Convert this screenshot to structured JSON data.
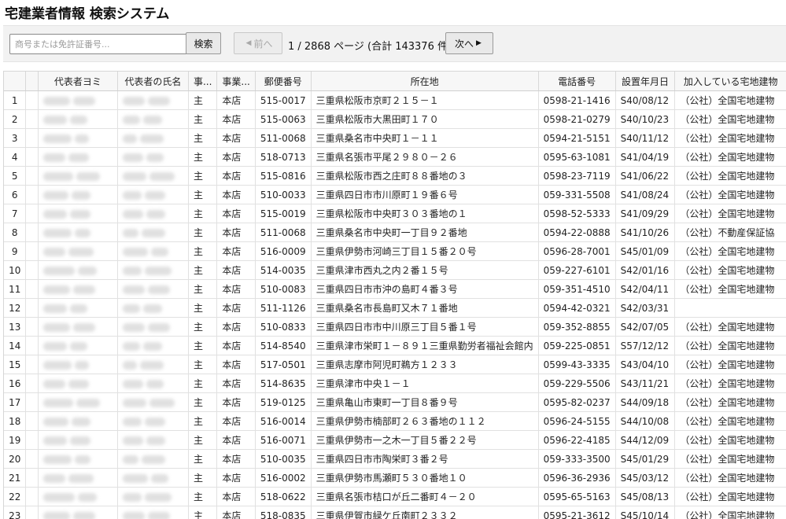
{
  "app": {
    "title": "宅建業者情報 検索システム"
  },
  "toolbar": {
    "search_placeholder": "商号または免許証番号...",
    "search_value": "",
    "search_label": "検索",
    "prev_label": "前へ",
    "next_label": "次へ",
    "page_info": "1 / 2868 ページ (合計 143376 件)"
  },
  "table": {
    "columns": [
      "",
      "",
      "代表者ヨミ",
      "代表者の氏名",
      "事...",
      "事業...",
      "郵便番号",
      "所在地",
      "電話番号",
      "設置年月日",
      "加入している宅地建物"
    ],
    "rows": [
      {
        "n": "1",
        "kind": "主",
        "office": "本店",
        "zip": "515-0017",
        "addr": "三重県松阪市京町２１５－１",
        "tel": "0598-21-1416",
        "date": "S40/08/12",
        "assoc": "（公社）全国宅地建物"
      },
      {
        "n": "2",
        "kind": "主",
        "office": "本店",
        "zip": "515-0063",
        "addr": "三重県松阪市大黒田町１７０",
        "tel": "0598-21-0279",
        "date": "S40/10/23",
        "assoc": "（公社）全国宅地建物"
      },
      {
        "n": "3",
        "kind": "主",
        "office": "本店",
        "zip": "511-0068",
        "addr": "三重県桑名市中央町１－１１",
        "tel": "0594-21-5151",
        "date": "S40/11/12",
        "assoc": "（公社）全国宅地建物"
      },
      {
        "n": "4",
        "kind": "主",
        "office": "本店",
        "zip": "518-0713",
        "addr": "三重県名張市平尾２９８０－２６",
        "tel": "0595-63-1081",
        "date": "S41/04/19",
        "assoc": "（公社）全国宅地建物"
      },
      {
        "n": "5",
        "kind": "主",
        "office": "本店",
        "zip": "515-0816",
        "addr": "三重県松阪市西之庄町８８番地の３",
        "tel": "0598-23-7119",
        "date": "S41/06/22",
        "assoc": "（公社）全国宅地建物"
      },
      {
        "n": "6",
        "kind": "主",
        "office": "本店",
        "zip": "510-0033",
        "addr": "三重県四日市市川原町１９番６号",
        "tel": "059-331-5508",
        "date": "S41/08/24",
        "assoc": "（公社）全国宅地建物"
      },
      {
        "n": "7",
        "kind": "主",
        "office": "本店",
        "zip": "515-0019",
        "addr": "三重県松阪市中央町３０３番地の１",
        "tel": "0598-52-5333",
        "date": "S41/09/29",
        "assoc": "（公社）全国宅地建物"
      },
      {
        "n": "8",
        "kind": "主",
        "office": "本店",
        "zip": "511-0068",
        "addr": "三重県桑名市中央町一丁目９２番地",
        "tel": "0594-22-0888",
        "date": "S41/10/26",
        "assoc": "（公社）不動産保証協"
      },
      {
        "n": "9",
        "kind": "主",
        "office": "本店",
        "zip": "516-0009",
        "addr": "三重県伊勢市河崎三丁目１５番２０号",
        "tel": "0596-28-7001",
        "date": "S45/01/09",
        "assoc": "（公社）全国宅地建物"
      },
      {
        "n": "10",
        "kind": "主",
        "office": "本店",
        "zip": "514-0035",
        "addr": "三重県津市西丸之内２番１５号",
        "tel": "059-227-6101",
        "date": "S42/01/16",
        "assoc": "（公社）全国宅地建物"
      },
      {
        "n": "11",
        "kind": "主",
        "office": "本店",
        "zip": "510-0083",
        "addr": "三重県四日市市沖の島町４番３号",
        "tel": "059-351-4510",
        "date": "S42/04/11",
        "assoc": "（公社）全国宅地建物"
      },
      {
        "n": "12",
        "kind": "主",
        "office": "本店",
        "zip": "511-1126",
        "addr": "三重県桑名市長島町又木７１番地",
        "tel": "0594-42-0321",
        "date": "S42/03/31",
        "assoc": ""
      },
      {
        "n": "13",
        "kind": "主",
        "office": "本店",
        "zip": "510-0833",
        "addr": "三重県四日市市中川原三丁目５番１号",
        "tel": "059-352-8855",
        "date": "S42/07/05",
        "assoc": "（公社）全国宅地建物"
      },
      {
        "n": "14",
        "kind": "主",
        "office": "本店",
        "zip": "514-8540",
        "addr": "三重県津市栄町１－８９１三重県勤労者福祉会館内",
        "tel": "059-225-0851",
        "date": "S57/12/12",
        "assoc": "（公社）全国宅地建物"
      },
      {
        "n": "15",
        "kind": "主",
        "office": "本店",
        "zip": "517-0501",
        "addr": "三重県志摩市阿児町鵜方１２３３",
        "tel": "0599-43-3335",
        "date": "S43/04/10",
        "assoc": "（公社）全国宅地建物"
      },
      {
        "n": "16",
        "kind": "主",
        "office": "本店",
        "zip": "514-8635",
        "addr": "三重県津市中央１－１",
        "tel": "059-229-5506",
        "date": "S43/11/21",
        "assoc": "（公社）全国宅地建物"
      },
      {
        "n": "17",
        "kind": "主",
        "office": "本店",
        "zip": "519-0125",
        "addr": "三重県亀山市東町一丁目８番９号",
        "tel": "0595-82-0237",
        "date": "S44/09/18",
        "assoc": "（公社）全国宅地建物"
      },
      {
        "n": "18",
        "kind": "主",
        "office": "本店",
        "zip": "516-0014",
        "addr": "三重県伊勢市楠部町２６３番地の１１２",
        "tel": "0596-24-5155",
        "date": "S44/10/08",
        "assoc": "（公社）全国宅地建物"
      },
      {
        "n": "19",
        "kind": "主",
        "office": "本店",
        "zip": "516-0071",
        "addr": "三重県伊勢市一之木一丁目５番２２号",
        "tel": "0596-22-4185",
        "date": "S44/12/09",
        "assoc": "（公社）全国宅地建物"
      },
      {
        "n": "20",
        "kind": "主",
        "office": "本店",
        "zip": "510-0035",
        "addr": "三重県四日市市陶栄町３番２号",
        "tel": "059-333-3500",
        "date": "S45/01/29",
        "assoc": "（公社）全国宅地建物"
      },
      {
        "n": "21",
        "kind": "主",
        "office": "本店",
        "zip": "516-0002",
        "addr": "三重県伊勢市馬瀬町５３０番地１０",
        "tel": "0596-36-2936",
        "date": "S45/03/12",
        "assoc": "（公社）全国宅地建物"
      },
      {
        "n": "22",
        "kind": "主",
        "office": "本店",
        "zip": "518-0622",
        "addr": "三重県名張市桔口が丘二番町４－２０",
        "tel": "0595-65-5163",
        "date": "S45/08/13",
        "assoc": "（公社）全国宅地建物"
      },
      {
        "n": "23",
        "kind": "主",
        "office": "本店",
        "zip": "518-0835",
        "addr": "三重県伊賀市緑ケ丘南町２３３２",
        "tel": "0595-21-3612",
        "date": "S45/10/14",
        "assoc": "（公社）全国宅地建物"
      }
    ]
  }
}
